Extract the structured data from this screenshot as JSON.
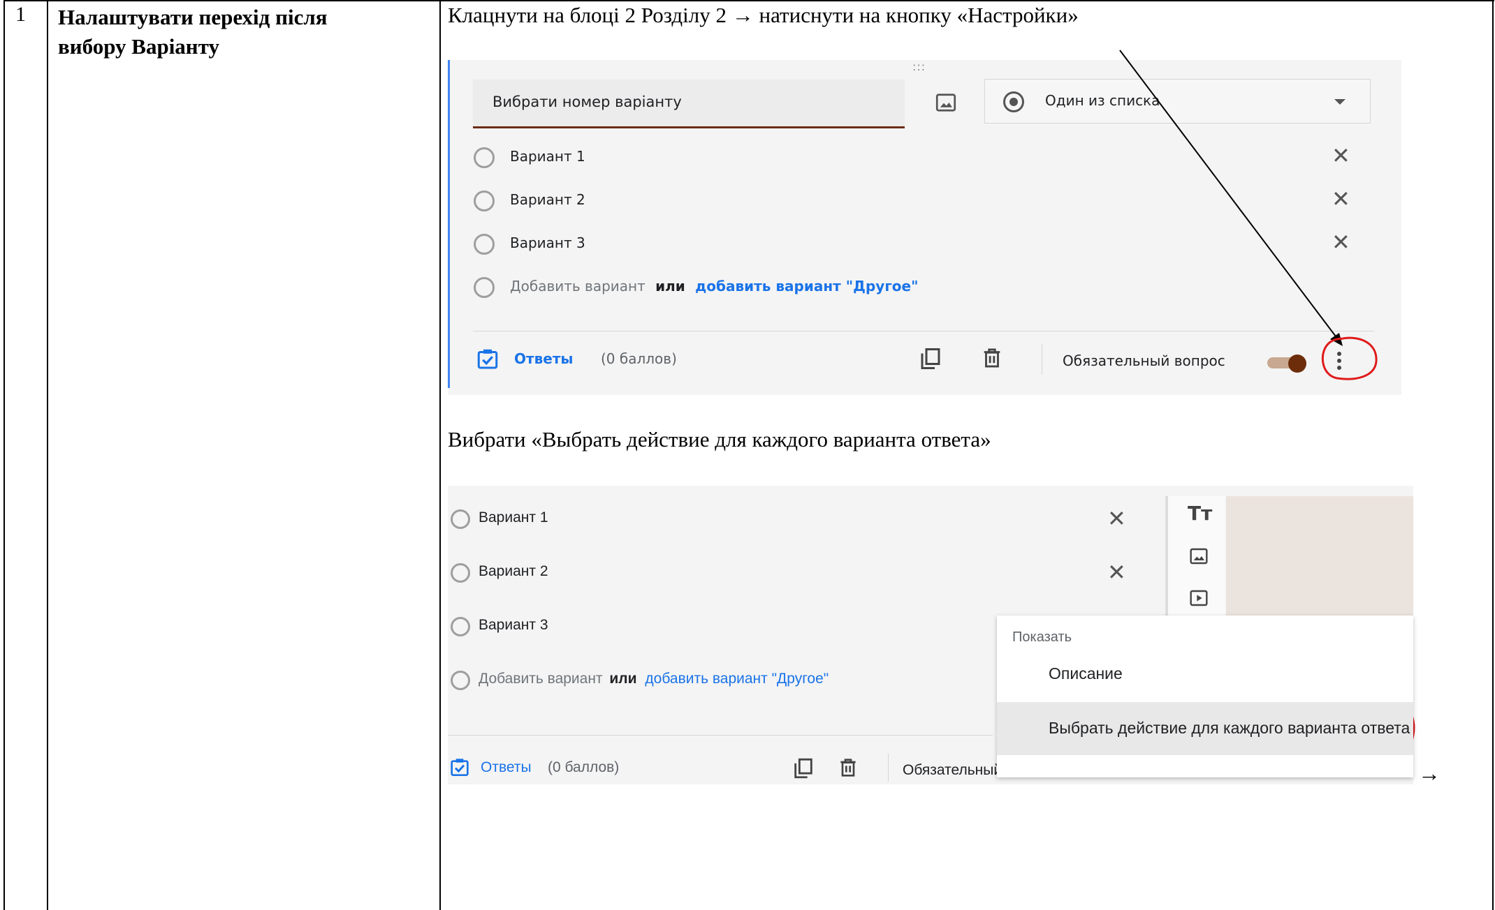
{
  "row": {
    "number": "1",
    "title_line1": "Налаштувати перехід після",
    "title_line2": "вибору Варіанту",
    "instruction1": "Клацнути на блоці 2 Розділу 2 → натиснути на кнопку «Настройки»",
    "instruction2": "Вибрати «Выбрать действие для каждого варианта ответа»",
    "trailing_arrow": "→"
  },
  "shot1": {
    "drag_handle": ":::",
    "question_title": "Вибрати номер варіанту",
    "question_type": "Один из списка",
    "options": [
      "Вариант 1",
      "Вариант 2",
      "Вариант 3"
    ],
    "add_option": "Добавить вариант",
    "or_text": "или",
    "add_other": "добавить вариант \"Другое\"",
    "answers_label": "Ответы",
    "points_label": "(0 баллов)",
    "required_label": "Обязательный вопрос",
    "toggle_color": "#6d2d0a",
    "annotation_color": "#e01b1b"
  },
  "shot2": {
    "options": [
      "Вариант 1",
      "Вариант 2",
      "Вариант 3"
    ],
    "add_option": "Добавить вариант",
    "or_text": "или",
    "add_other": "добавить вариант \"Другое\"",
    "answers_label": "Ответы",
    "points_label": "(0 баллов)",
    "required_label": "Обязательный",
    "menu_header": "Показать",
    "menu_item_description": "Описание",
    "menu_item_action": "Выбрать действие для каждого варианта ответа"
  }
}
